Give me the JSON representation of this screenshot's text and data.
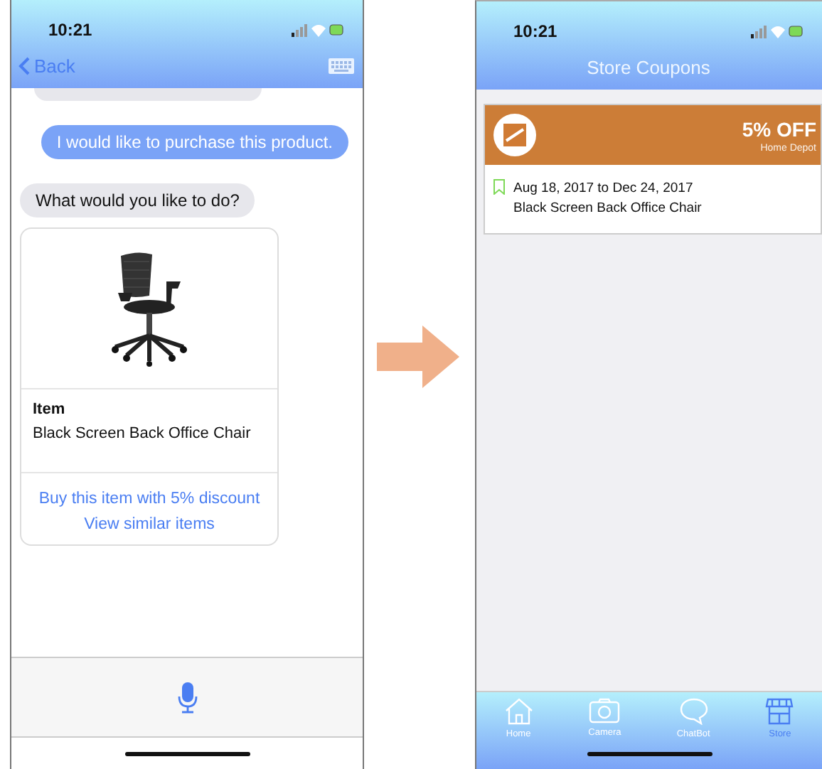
{
  "chat_screen": {
    "status_bar": {
      "time": "10:21"
    },
    "nav": {
      "back": "Back"
    },
    "messages": [
      {
        "kind": "partial"
      },
      {
        "kind": "user",
        "text": "I would like to purchase this product."
      },
      {
        "kind": "bot",
        "text": "What would you like to do?"
      }
    ],
    "product_card": {
      "label": "Item",
      "name": "Black Screen Back Office Chair",
      "actions": [
        "Buy this item with 5% discount",
        "View similar items"
      ]
    }
  },
  "coupons_screen": {
    "status_bar": {
      "time": "10:21"
    },
    "title": "Store Coupons",
    "coupons": [
      {
        "discount": "5% OFF",
        "store": "Home Depot",
        "dates": "Aug 18, 2017 to Dec 24, 2017",
        "item": "Black Screen Back Office Chair",
        "saved": false
      }
    ],
    "tabs": [
      {
        "label": "Home",
        "selected": false
      },
      {
        "label": "Camera",
        "selected": false
      },
      {
        "label": "ChatBot",
        "selected": false
      },
      {
        "label": "Store",
        "selected": true
      }
    ]
  }
}
